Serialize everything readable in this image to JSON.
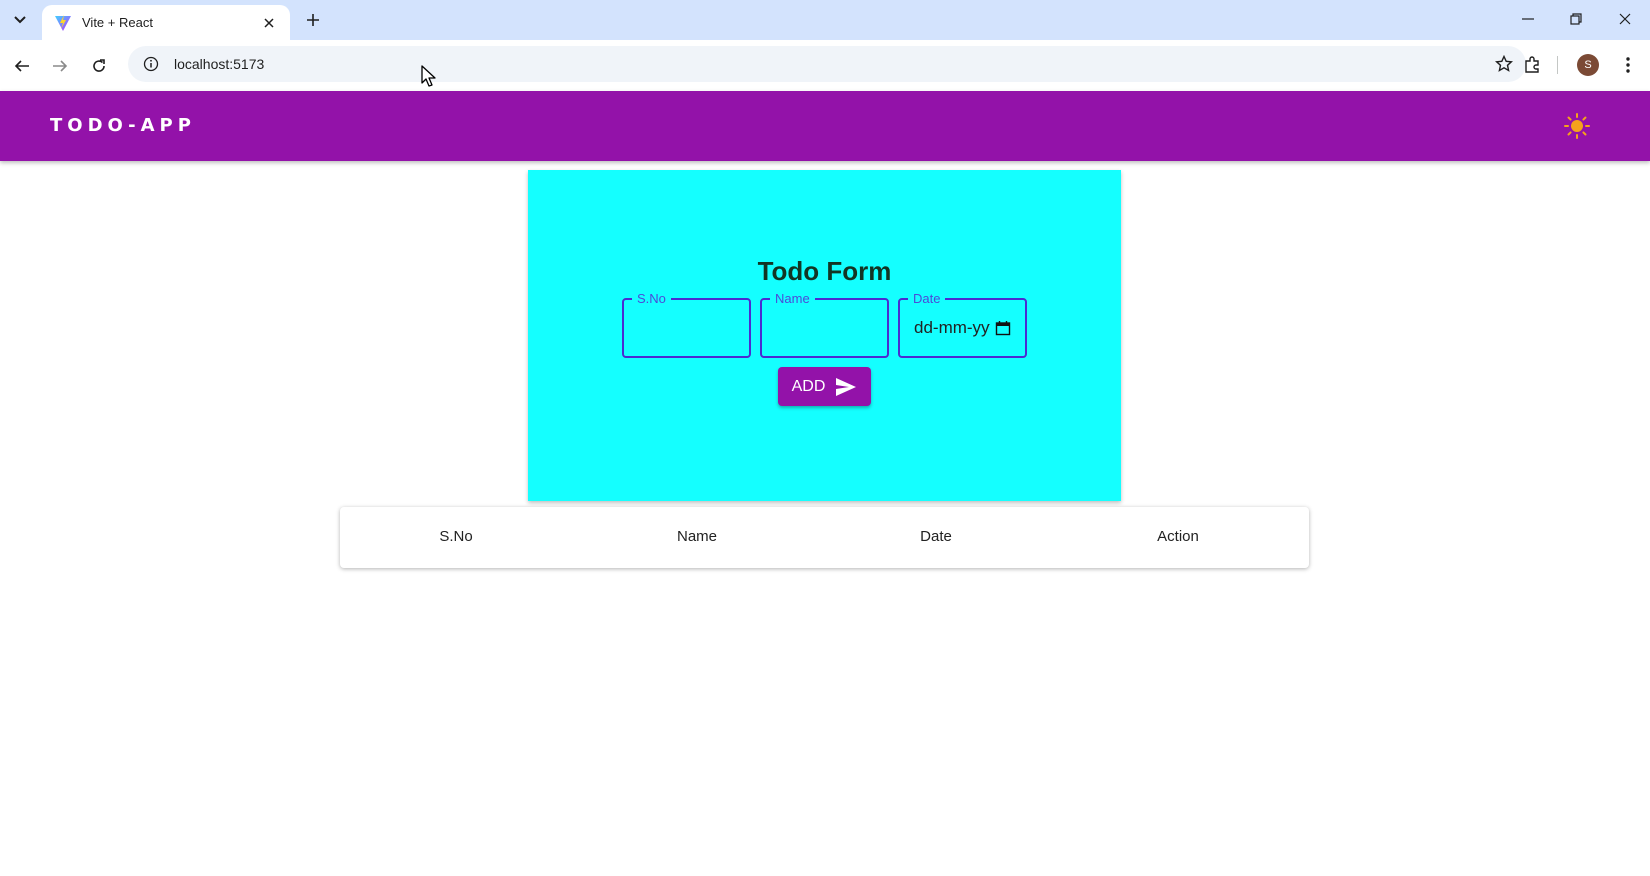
{
  "browser": {
    "tab_title": "Vite + React",
    "url": "localhost:5173",
    "profile_initial": "S",
    "icons": [
      "tab-search-icon",
      "vite-favicon-icon",
      "close-tab-icon",
      "new-tab-icon",
      "minimize-icon",
      "restore-icon",
      "close-window-icon",
      "back-icon",
      "forward-icon",
      "reload-icon",
      "site-info-icon",
      "bookmark-star-icon",
      "extensions-icon",
      "menu-dots-icon"
    ]
  },
  "app": {
    "brand": "TODO-APP",
    "theme_icon": "sun-icon",
    "accent_color": "#9312a9",
    "card_color": "#14ffff"
  },
  "form": {
    "title": "Todo Form",
    "fields": [
      {
        "legend": "S.No",
        "value": ""
      },
      {
        "legend": "Name",
        "value": ""
      },
      {
        "legend": "Date",
        "value": "dd-mm-yyyy"
      }
    ],
    "add_label": "ADD"
  },
  "table": {
    "headers": [
      "S.No",
      "Name",
      "Date",
      "Action"
    ]
  }
}
